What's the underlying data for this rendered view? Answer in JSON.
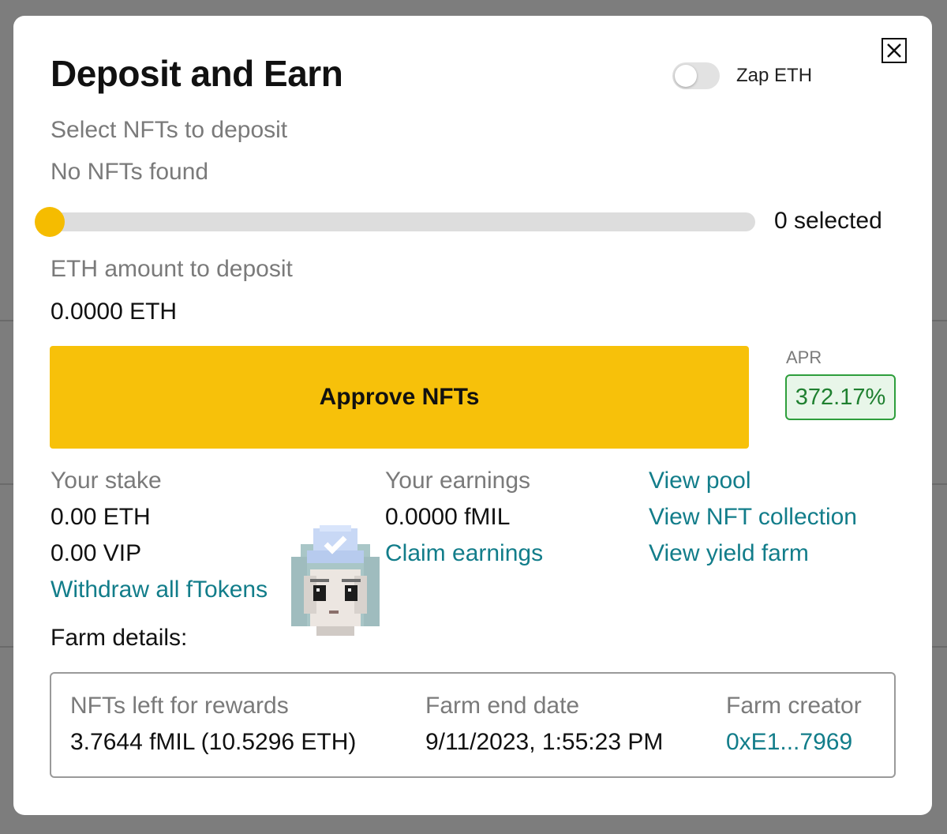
{
  "modal": {
    "title": "Deposit and Earn",
    "zap_label": "Zap ETH",
    "zap_enabled": false
  },
  "nft_select": {
    "label": "Select NFTs to deposit",
    "empty_text": "No NFTs found",
    "slider_value": 0,
    "selected_text": "0 selected"
  },
  "eth_deposit": {
    "label": "ETH amount to deposit",
    "value": "0.0000 ETH"
  },
  "approve": {
    "label": "Approve NFTs",
    "color": "#f7c10a"
  },
  "apr": {
    "label": "APR",
    "value": "372.17%",
    "color": "#2e9e3c"
  },
  "stake": {
    "label": "Your stake",
    "eth": "0.00 ETH",
    "vip": "0.00 VIP",
    "withdraw_link": "Withdraw all fTokens"
  },
  "earnings": {
    "label": "Your earnings",
    "value": "0.0000 fMIL",
    "claim_link": "Claim earnings"
  },
  "links": {
    "view_pool": "View pool",
    "view_nft_collection": "View NFT collection",
    "view_yield_farm": "View yield farm"
  },
  "farm": {
    "heading": "Farm details:",
    "nfts_left_label": "NFTs left for rewards",
    "nfts_left_value": "3.7644 fMIL (10.5296 ETH)",
    "end_date_label": "Farm end date",
    "end_date_value": "9/11/2023, 1:55:23 PM",
    "creator_label": "Farm creator",
    "creator_value": "0xE1...7969"
  },
  "theme": {
    "link_color": "#127d8a",
    "accent": "#f5bc00"
  },
  "icons": {
    "close": "close-icon",
    "avatar": "pixel-avatar-icon"
  }
}
